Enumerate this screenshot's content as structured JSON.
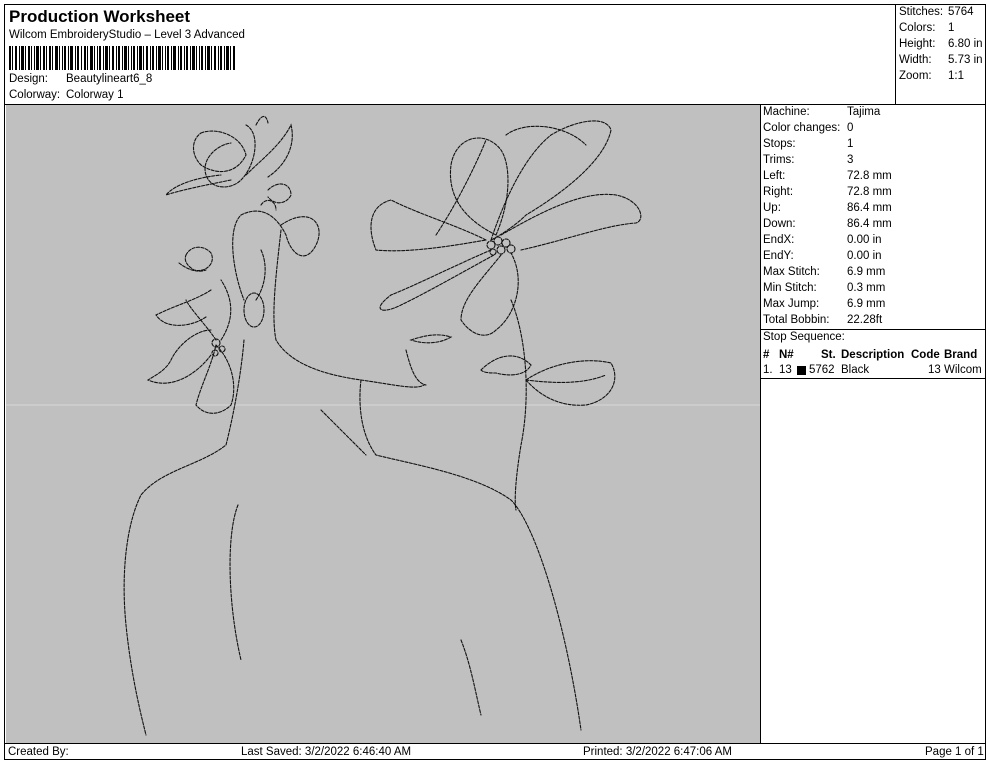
{
  "header": {
    "title": "Production Worksheet",
    "subtitle": "Wilcom EmbroideryStudio – Level 3 Advanced",
    "design_label": "Design:",
    "design_value": "Beautylineart6_8",
    "colorway_label": "Colorway:",
    "colorway_value": "Colorway 1"
  },
  "stats": {
    "stitches_label": "Stitches:",
    "stitches": "5764",
    "colors_label": "Colors:",
    "colors": "1",
    "height_label": "Height:",
    "height": "6.80 in",
    "width_label": "Width:",
    "width": "5.73 in",
    "zoom_label": "Zoom:",
    "zoom": "1:1"
  },
  "machine_info": {
    "machine_label": "Machine:",
    "machine": "Tajima",
    "color_changes_label": "Color changes:",
    "color_changes": "0",
    "stops_label": "Stops:",
    "stops": "1",
    "trims_label": "Trims:",
    "trims": "3",
    "left_label": "Left:",
    "left": "72.8 mm",
    "right_label": "Right:",
    "right": "72.8 mm",
    "up_label": "Up:",
    "up": "86.4 mm",
    "down_label": "Down:",
    "down": "86.4 mm",
    "endx_label": "EndX:",
    "endx": "0.00 in",
    "endy_label": "EndY:",
    "endy": "0.00 in",
    "max_stitch_label": "Max Stitch:",
    "max_stitch": "6.9 mm",
    "min_stitch_label": "Min Stitch:",
    "min_stitch": "0.3 mm",
    "max_jump_label": "Max Jump:",
    "max_jump": "6.9 mm",
    "total_bobbin_label": "Total Bobbin:",
    "total_bobbin": "22.28ft"
  },
  "stop_sequence": {
    "title": "Stop Sequence:",
    "headers": [
      "#",
      "N#",
      "St.",
      "Description",
      "Code",
      "Brand"
    ],
    "rows": [
      {
        "index": "1.",
        "n": "13",
        "swatch_color": "#000000",
        "stitches": "5762",
        "description": "Black",
        "code": "13",
        "brand": "Wilcom"
      }
    ]
  },
  "footer": {
    "created_by": "Created By:",
    "last_saved": "Last Saved: 3/2/2022 6:46:40 AM",
    "printed": "Printed: 3/2/2022 6:47:06 AM",
    "page": "Page 1 of 1"
  }
}
